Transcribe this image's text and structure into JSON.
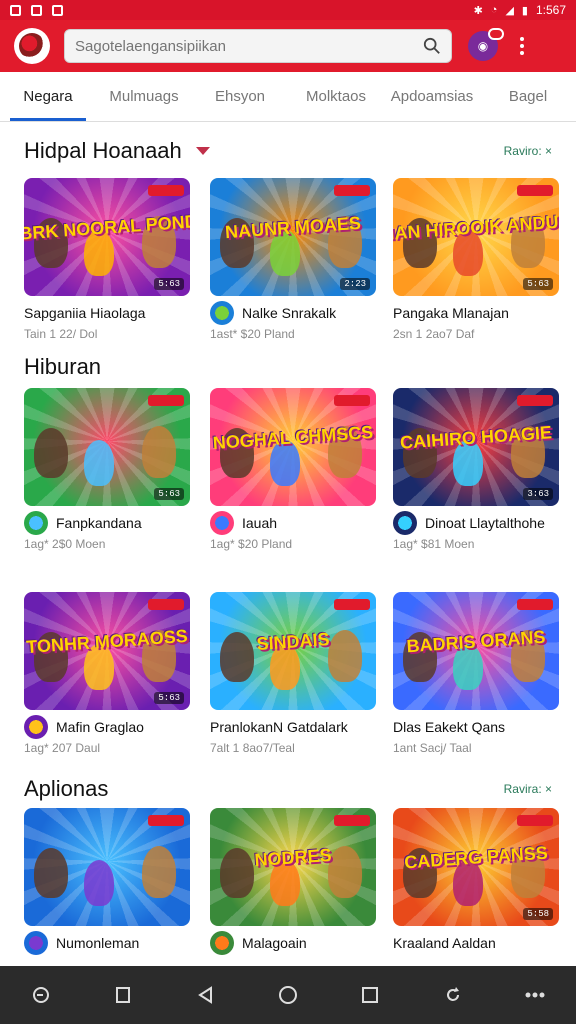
{
  "status_bar": {
    "time": "1:567"
  },
  "search": {
    "placeholder": "Sagotelaengansipiikan"
  },
  "tabs": [
    {
      "label": "Negara",
      "active": true
    },
    {
      "label": "Mulmuags",
      "active": false
    },
    {
      "label": "Ehsyon",
      "active": false
    },
    {
      "label": "Molktaos",
      "active": false
    },
    {
      "label": "Apdoamsias",
      "active": false
    },
    {
      "label": "Bagel",
      "active": false
    }
  ],
  "sections": [
    {
      "title": "Hidpal Hoanaah",
      "see_more": "Raviro: ×"
    },
    {
      "title": "Hiburan",
      "see_more": ""
    },
    {
      "title": "Aplionas",
      "see_more": "Ravira: ×"
    }
  ],
  "cards": [
    {
      "art": "NOBRK NOORAL PONDES",
      "name": "Sapganiia Hiaolaga",
      "meta": "Tain 1 22/ Dol",
      "badge": "5:63",
      "colors": [
        "#7a1fb0",
        "#ff4fa0",
        "#ffb300"
      ]
    },
    {
      "art": "NAUNR MOAES",
      "name": "Nalke Snrakalk",
      "meta": "1ast* $20 Pland",
      "badge": "2:23",
      "colors": [
        "#1b7fd8",
        "#ff8a00",
        "#7ad13a"
      ]
    },
    {
      "art": "RAGHIAN HIROOIK ANDUGRIAS",
      "name": "Pangaka Mlanajan",
      "meta": "2sn 1 2ao7 Daf",
      "badge": "5:63",
      "colors": [
        "#ff9a1f",
        "#ffd84a",
        "#e84a2a"
      ]
    },
    {
      "art": "",
      "name": "Fanpkandana",
      "meta": "1ag* 2$0 Moen",
      "badge": "5:63",
      "colors": [
        "#2aa84a",
        "#ff4a6a",
        "#4ac0ff"
      ]
    },
    {
      "art": "NOGHAL CHMSCS",
      "name": "Iauah",
      "meta": "1ag* $20 Pland",
      "badge": "",
      "colors": [
        "#ff3d7a",
        "#ffcf33",
        "#3a7aff"
      ]
    },
    {
      "art": "CAIHIRO HOAGIE",
      "name": "Dinoat Llaytalthohe",
      "meta": "1ag* $81 Moen",
      "badge": "3:63",
      "colors": [
        "#1a2a6a",
        "#ff3d3d",
        "#35d0ff"
      ]
    },
    {
      "art": "TONHR MORAOSS",
      "name": "Mafin Graglao",
      "meta": "1ag* 207 Daul",
      "badge": "5:63",
      "colors": [
        "#6a1fb0",
        "#ff4fa0",
        "#ffc21a"
      ]
    },
    {
      "art": "SINDAIS",
      "name": "PranlokanN Gatdalark",
      "meta": "7alt 1 8ao7/Teal",
      "badge": "",
      "colors": [
        "#2ab0ff",
        "#7ad13a",
        "#ff9a1f"
      ]
    },
    {
      "art": "BADRIS ORANS",
      "name": "Dlas Eakekt Qans",
      "meta": "1ant Sacj/ Taal",
      "badge": "",
      "colors": [
        "#3a6aff",
        "#ff4fa0",
        "#3ad1c0"
      ]
    },
    {
      "art": "",
      "name": "Numonleman",
      "meta": "",
      "badge": "",
      "colors": [
        "#1a6ad8",
        "#4ac0ff",
        "#7a3ad0"
      ]
    },
    {
      "art": "NODRES",
      "name": "Malagoain",
      "meta": "",
      "badge": "",
      "colors": [
        "#3a8a3a",
        "#ffd84a",
        "#ff7a1a"
      ]
    },
    {
      "art": "CADERG PANSS",
      "name": "Kraaland Aaldan",
      "meta": "",
      "badge": "5:58",
      "colors": [
        "#e84a1a",
        "#ffcf33",
        "#b02070"
      ]
    }
  ],
  "nav": [
    "back-circle",
    "square",
    "triangle-back",
    "home",
    "recents",
    "refresh",
    "more"
  ]
}
